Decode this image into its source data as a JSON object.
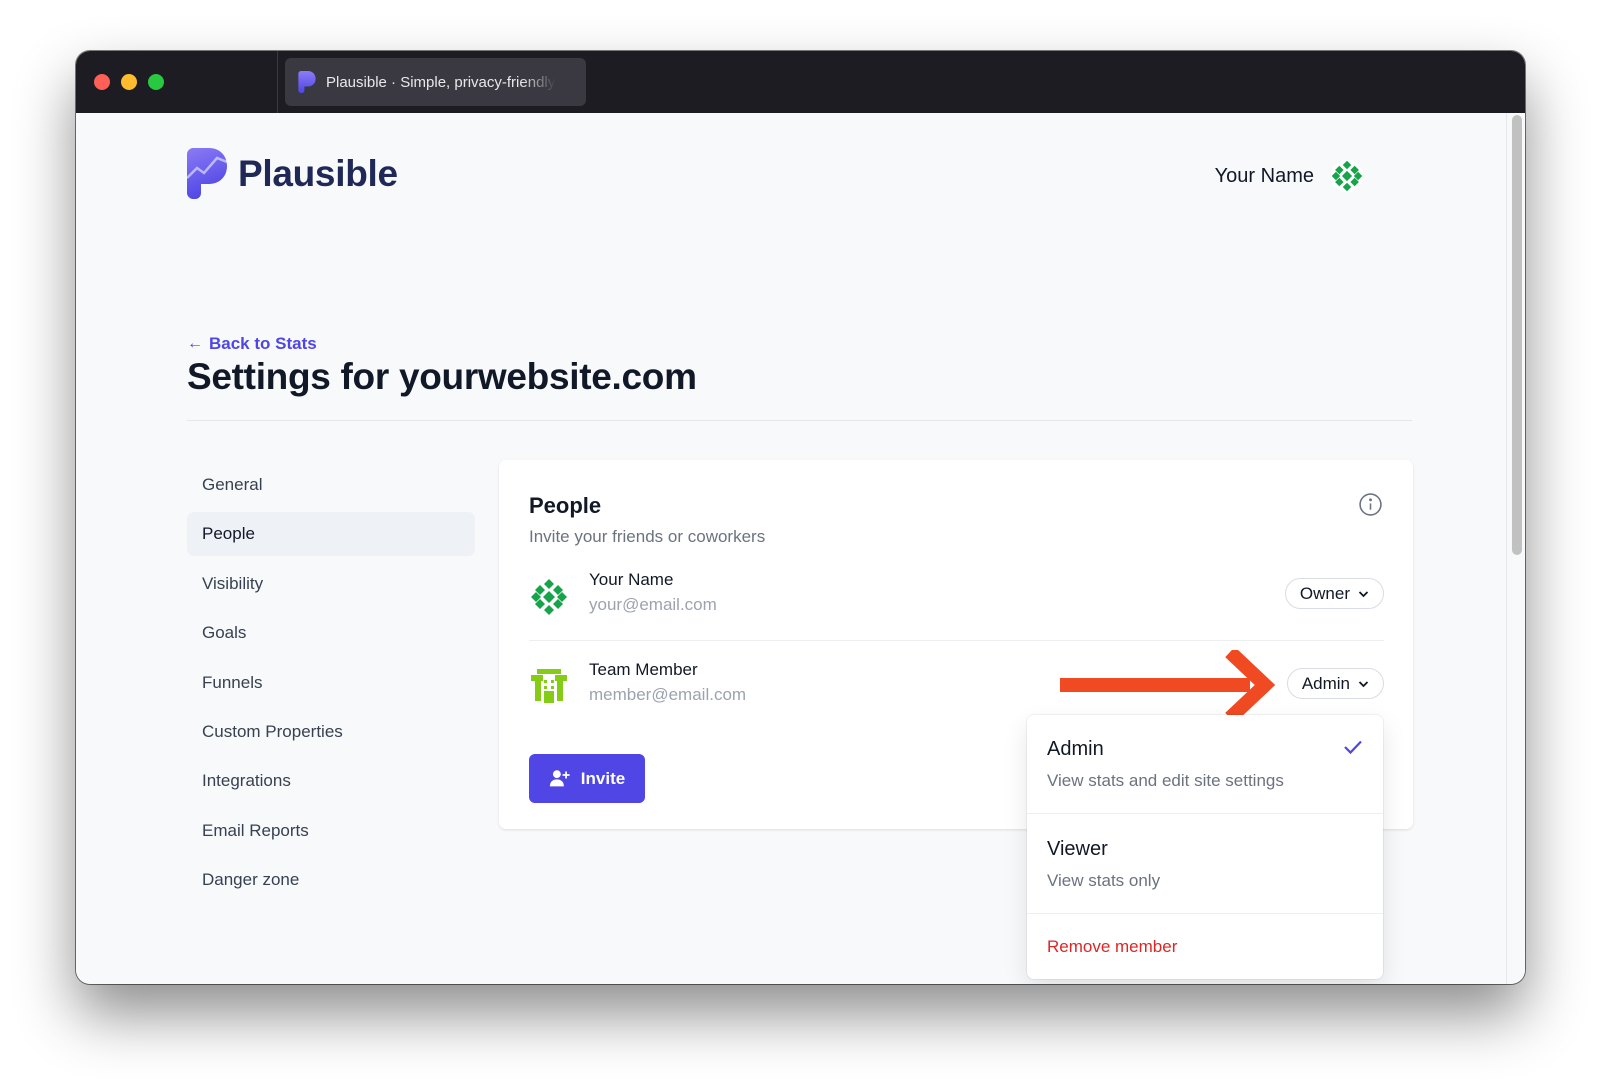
{
  "browser": {
    "tab_title": "Plausible · Simple, privacy-friendly analytics",
    "favicon": "plausible-logo-icon"
  },
  "header": {
    "brand": "Plausible",
    "user_name": "Your Name",
    "avatar": "identicon-green"
  },
  "page": {
    "back_link": "Back to Stats",
    "back_icon": "←",
    "title": "Settings for yourwebsite.com"
  },
  "sidebar": {
    "active": "People",
    "items": [
      {
        "label": "General"
      },
      {
        "label": "People"
      },
      {
        "label": "Visibility"
      },
      {
        "label": "Goals"
      },
      {
        "label": "Funnels"
      },
      {
        "label": "Custom Properties"
      },
      {
        "label": "Integrations"
      },
      {
        "label": "Email Reports"
      },
      {
        "label": "Danger zone"
      }
    ]
  },
  "people_card": {
    "title": "People",
    "subtitle": "Invite your friends or coworkers",
    "members": [
      {
        "name": "Your Name",
        "email": "your@email.com",
        "role": "Owner",
        "avatar": "identicon-green"
      },
      {
        "name": "Team Member",
        "email": "member@email.com",
        "role": "Admin",
        "avatar": "identicon-lime"
      }
    ],
    "invite_label": "Invite"
  },
  "role_dropdown": {
    "options": [
      {
        "title": "Admin",
        "description": "View stats and edit site settings",
        "selected": true
      },
      {
        "title": "Viewer",
        "description": "View stats only",
        "selected": false
      }
    ],
    "remove_label": "Remove member"
  },
  "colors": {
    "accent": "#4f46e5",
    "brand_text": "#1f2856",
    "danger": "#dc2626",
    "annotation_arrow": "#f04a23"
  }
}
